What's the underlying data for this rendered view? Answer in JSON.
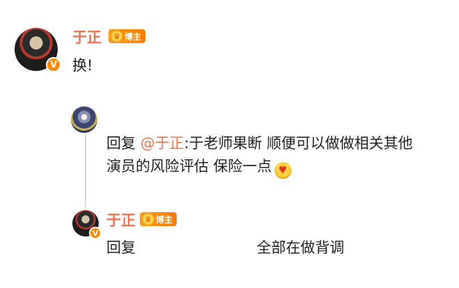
{
  "post": {
    "author": "于正",
    "badge": "博主",
    "verified_mark": "V",
    "content": "换!"
  },
  "comment": {
    "reply_prefix": "回复",
    "mention": "@于正",
    "text_line1": ":于老师果断 顺便可以做做相关其他",
    "text_line2": "演员的风险评估 保险一点",
    "emoji": "kiss-heart-emoji"
  },
  "reply": {
    "author": "于正",
    "badge": "博主",
    "verified_mark": "V",
    "reply_label": "回复",
    "text": "全部在做背调"
  },
  "colors": {
    "username": "#eb7350",
    "badge_orange": "#ff8a00",
    "text": "#222222",
    "thread_line": "#d9d9d9"
  }
}
